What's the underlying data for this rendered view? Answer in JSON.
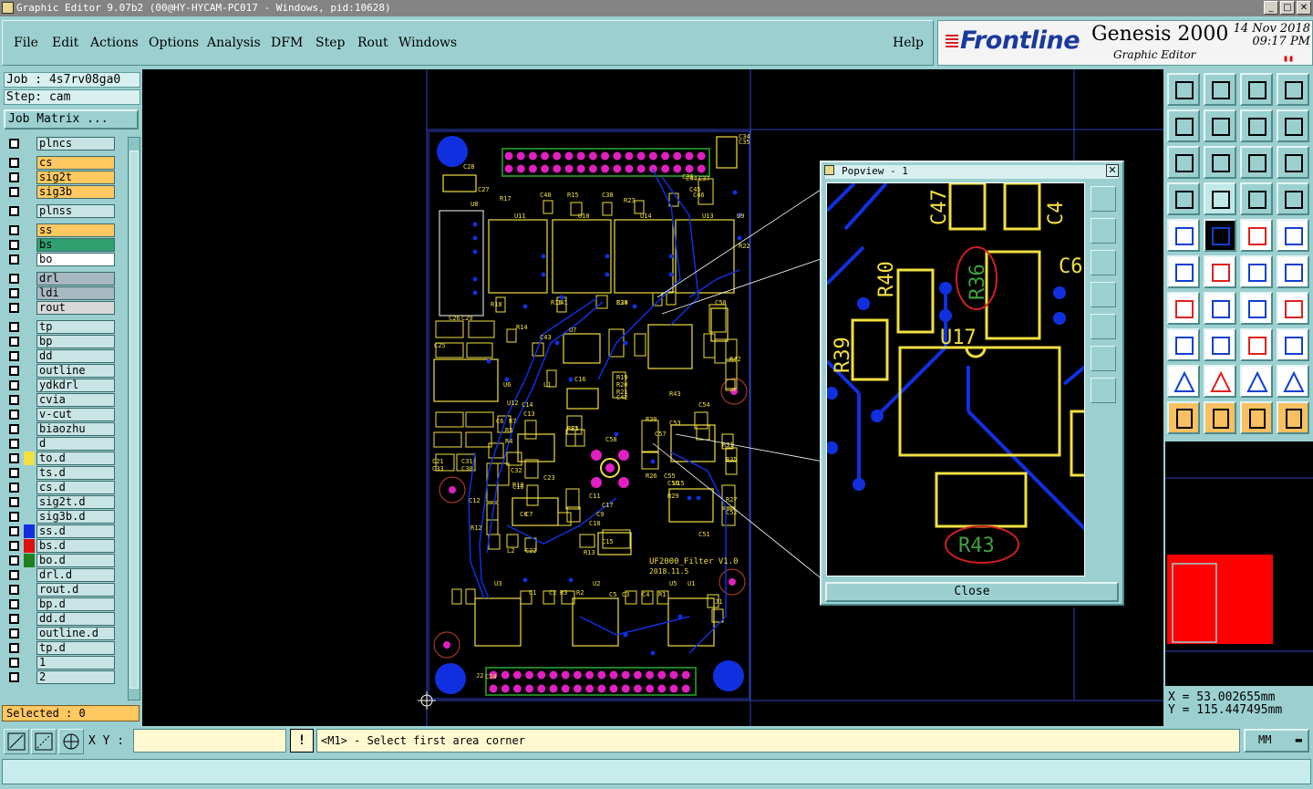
{
  "window": {
    "title": "Graphic Editor 9.07b2 (00@HY-HYCAM-PC017 - Windows, pid:10628)"
  },
  "menu": {
    "items": [
      "File",
      "Edit",
      "Actions",
      "Options",
      "Analysis",
      "DFM",
      "Step",
      "Rout",
      "Windows"
    ],
    "help": "Help"
  },
  "brand": {
    "logo": "Frontline",
    "product": "Genesis 2000",
    "subtitle": "Graphic Editor",
    "date": "14 Nov 2018",
    "time": "09:17 PM"
  },
  "job": {
    "job_label": "Job : 4s7rv08ga0",
    "step_label": "Step: cam",
    "matrix_button": "Job Matrix ..."
  },
  "layers": [
    {
      "name": "plncs",
      "bg": "#c8e4e4",
      "sw": ""
    },
    {
      "name": "cs",
      "bg": "#ffc860",
      "sw": ""
    },
    {
      "name": "sig2t",
      "bg": "#ffc860",
      "sw": ""
    },
    {
      "name": "sig3b",
      "bg": "#ffc860",
      "sw": ""
    },
    {
      "name": "plnss",
      "bg": "#c8e4e4",
      "sw": ""
    },
    {
      "name": "ss",
      "bg": "#ffc860",
      "sw": ""
    },
    {
      "name": "bs",
      "bg": "#30a070",
      "sw": ""
    },
    {
      "name": "bo",
      "bg": "#ffffff",
      "sw": ""
    },
    {
      "name": "drl",
      "bg": "#a8b8c0",
      "sw": ""
    },
    {
      "name": "ldi",
      "bg": "#a8b8c0",
      "sw": ""
    },
    {
      "name": "rout",
      "bg": "#d8d8d8",
      "sw": ""
    },
    {
      "name": "tp",
      "bg": "#c8e4e4",
      "sw": ""
    },
    {
      "name": "bp",
      "bg": "#c8e4e4",
      "sw": ""
    },
    {
      "name": "dd",
      "bg": "#c8e4e4",
      "sw": ""
    },
    {
      "name": "outline",
      "bg": "#c8e4e4",
      "sw": ""
    },
    {
      "name": "ydkdrl",
      "bg": "#c8e4e4",
      "sw": ""
    },
    {
      "name": "cvia",
      "bg": "#c8e4e4",
      "sw": ""
    },
    {
      "name": "v-cut",
      "bg": "#c8e4e4",
      "sw": ""
    },
    {
      "name": "biaozhu",
      "bg": "#c8e4e4",
      "sw": ""
    },
    {
      "name": "d",
      "bg": "#c8e4e4",
      "sw": ""
    },
    {
      "name": "to.d",
      "bg": "#c8e4e4",
      "sw": "#f0e040"
    },
    {
      "name": "ts.d",
      "bg": "#c8e4e4",
      "sw": ""
    },
    {
      "name": "cs.d",
      "bg": "#c8e4e4",
      "sw": ""
    },
    {
      "name": "sig2t.d",
      "bg": "#c8e4e4",
      "sw": ""
    },
    {
      "name": "sig3b.d",
      "bg": "#c8e4e4",
      "sw": ""
    },
    {
      "name": "ss.d",
      "bg": "#c8e4e4",
      "sw": "#1030e0"
    },
    {
      "name": "bs.d",
      "bg": "#c8e4e4",
      "sw": "#e01010"
    },
    {
      "name": "bo.d",
      "bg": "#c8e4e4",
      "sw": "#208020"
    },
    {
      "name": "drl.d",
      "bg": "#c8e4e4",
      "sw": ""
    },
    {
      "name": "rout.d",
      "bg": "#c8e4e4",
      "sw": ""
    },
    {
      "name": "bp.d",
      "bg": "#c8e4e4",
      "sw": ""
    },
    {
      "name": "dd.d",
      "bg": "#c8e4e4",
      "sw": ""
    },
    {
      "name": "outline.d",
      "bg": "#c8e4e4",
      "sw": ""
    },
    {
      "name": "tp.d",
      "bg": "#c8e4e4",
      "sw": ""
    },
    {
      "name": "1",
      "bg": "#c8e4e4",
      "sw": ""
    },
    {
      "name": "2",
      "bg": "#c8e4e4",
      "sw": ""
    }
  ],
  "selected_label": "Selected : 0",
  "popview": {
    "title": "Popview - 1",
    "close": "Close",
    "labels": [
      "C47",
      "C4",
      "R40",
      "R36",
      "C6",
      "R39",
      "U17",
      "R43"
    ]
  },
  "pcb": {
    "board_text_1": "UF2000_Filter V1.0",
    "board_text_2": "2018.11.5",
    "refs": [
      "U11",
      "U10",
      "U14",
      "U13",
      "U9",
      "U8",
      "U12",
      "U7",
      "U6",
      "U15",
      "U5",
      "U3",
      "U2",
      "U1",
      "C28",
      "C27",
      "R17",
      "C40",
      "R15",
      "C38",
      "R23",
      "C34",
      "C35",
      "C36",
      "C37",
      "R22",
      "R18",
      "C41",
      "R16",
      "C39",
      "R24",
      "C50",
      "R14",
      "C43",
      "C16",
      "C44",
      "C45",
      "C46",
      "R19",
      "R20",
      "R21",
      "C42",
      "R42",
      "R43",
      "C14",
      "C13",
      "L1",
      "C54",
      "R30",
      "C53",
      "R31",
      "R35",
      "R27",
      "C52",
      "C51",
      "R29",
      "R26",
      "C55",
      "C56",
      "C57",
      "C58",
      "R25",
      "E1",
      "C8",
      "C7",
      "C10",
      "C11",
      "C17",
      "C18",
      "C9",
      "R10",
      "R13",
      "C15",
      "L2",
      "C22",
      "C23",
      "C21",
      "C33",
      "C31",
      "C30",
      "C32",
      "C12",
      "R12",
      "C6",
      "R7",
      "R5",
      "R4",
      "R3",
      "R2",
      "C5",
      "C3",
      "C4",
      "R1",
      "C1",
      "C2",
      "J1",
      "J2",
      "C24",
      "C26",
      "C29",
      "C25"
    ]
  },
  "coords": {
    "x": "X = 53.002655mm",
    "y": "Y = 115.447495mm"
  },
  "status": {
    "xy_label": "X Y :",
    "bang": "!",
    "message": "<M1> - Select first area corner",
    "unit": "MM"
  },
  "colors": {
    "panel": "#9cd0d0",
    "silk": "#f0e040",
    "trace": "#1030e0",
    "pad": "#e020c0",
    "outline": "#3040c0"
  }
}
